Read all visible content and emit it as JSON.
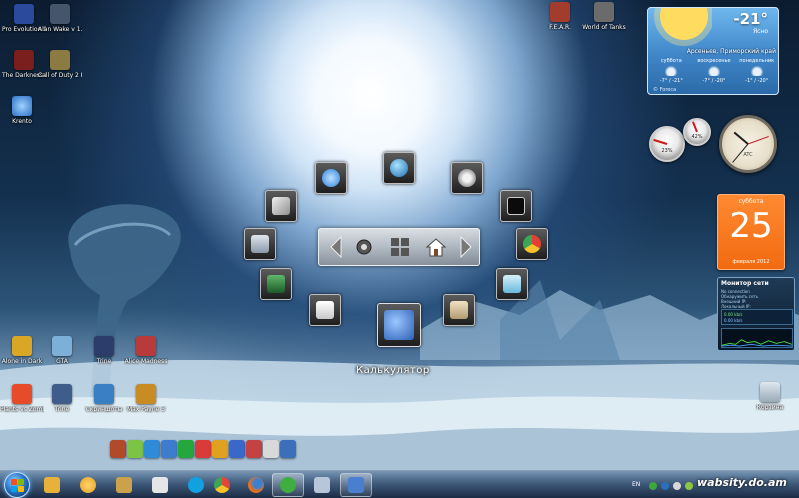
{
  "desktop": {
    "icons_top": [
      {
        "label": "Pro Evolution Soccer 2010",
        "color": "#2b4a9b"
      },
      {
        "label": "Alan Wake v 1.00.16.12...",
        "color": "#43566b"
      },
      {
        "label": "The Darkness Enhanced Edition",
        "color": "#7a1e1e"
      },
      {
        "label": "Call of Duty 2 Enhanced E...",
        "color": "#8c7a43"
      },
      {
        "label": "Krento",
        "color": "#2c6fc4"
      },
      {
        "label": "F.E.A.R.",
        "color": "#a33c2c"
      },
      {
        "label": "World of Tanks",
        "color": "#6b6b6b"
      }
    ],
    "icons_bottom": [
      {
        "label": "Alone in Dark",
        "color": "#d9a626"
      },
      {
        "label": "GTA",
        "color": "#7db0d8"
      },
      {
        "label": "Trine",
        "color": "#2d3d6b"
      },
      {
        "label": "Alice Madness",
        "color": "#b83a3a"
      },
      {
        "label": "Plants vs Zombies",
        "color": "#e64b2a"
      },
      {
        "label": "Trine",
        "color": "#3e5d8a"
      },
      {
        "label": "Скриншоты",
        "color": "#3a7ec4"
      },
      {
        "label": "Max Payne 3",
        "color": "#c98b23"
      },
      {
        "label": "Корзина",
        "color": "#9aaab8"
      }
    ],
    "dock_colors": [
      "#b04a2a",
      "#7cc443",
      "#2e8bd8",
      "#3e7cd0",
      "#24a83e",
      "#d93a3a",
      "#e0a020",
      "#3a68c9",
      "#c44242",
      "#d9d9d9",
      "#3b6fb9"
    ]
  },
  "launcher": {
    "caption": "Калькулятор",
    "items": [
      {
        "name": "ie",
        "color": "#2a7fe0"
      },
      {
        "name": "network",
        "color": "#3b9ad9"
      },
      {
        "name": "settings",
        "color": "#c9c9c9"
      },
      {
        "name": "tools",
        "color": "#dddddd"
      },
      {
        "name": "terminal",
        "color": "#1a1a1a"
      },
      {
        "name": "control",
        "color": "#9aa8b8"
      },
      {
        "name": "chrome",
        "color": "#e34133"
      },
      {
        "name": "picture",
        "color": "#2e8b3c"
      },
      {
        "name": "notes",
        "color": "#7ac8e8"
      },
      {
        "name": "document",
        "color": "#e7e7e7"
      },
      {
        "name": "paint",
        "color": "#d8c8a0"
      },
      {
        "name": "calculator",
        "color": "#3c77c9"
      }
    ]
  },
  "weather": {
    "temp": "-21°",
    "condition": "Ясно",
    "location": "Арсеньев, Приморский край",
    "forecast": [
      {
        "day": "суббота",
        "temp": "-7° / -21°"
      },
      {
        "day": "воскресенье",
        "temp": "-7° / -20°"
      },
      {
        "day": "понедельник",
        "temp": "-1° / -20°"
      }
    ],
    "source": "© Foreca"
  },
  "meters": {
    "cpu_percent": 23,
    "ram_percent": 42,
    "cpu_label": "23%",
    "ram_label": "42%"
  },
  "clock": {
    "brand": "ATC"
  },
  "calendar": {
    "day_of_week": "суббота",
    "day": "25",
    "month_year": "февраля 2012"
  },
  "network": {
    "title": "Монитор сети",
    "lines": [
      "No connection",
      "Обнаружить сеть",
      "Внешний IP:",
      "Локальный IP:"
    ],
    "down": "0.00 kb/s",
    "up": "0.00 kb/s"
  },
  "taskbar": {
    "lang": "EN",
    "watermark": "wabsity.do.am",
    "items": [
      {
        "name": "explorer",
        "color": "#e8b23a"
      },
      {
        "name": "player",
        "color": "#e7a424"
      },
      {
        "name": "tool",
        "color": "#c9a24a"
      },
      {
        "name": "docs",
        "color": "#e6e6e6"
      },
      {
        "name": "skype",
        "color": "#11a0e0"
      },
      {
        "name": "chrome",
        "color": "#e0463a"
      },
      {
        "name": "firefox",
        "color": "#e6711d"
      },
      {
        "name": "chat",
        "color": "#3fae3f"
      },
      {
        "name": "app",
        "color": "#b7c6d8"
      },
      {
        "name": "window",
        "color": "#4a7fd0"
      }
    ],
    "tray_colors": [
      "#3aa83a",
      "#2a6fb9",
      "#d9d9d9",
      "#8cc63f",
      "#d9d9d9"
    ]
  }
}
